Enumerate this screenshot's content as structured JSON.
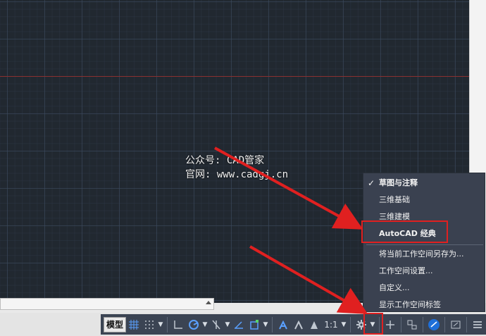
{
  "watermark": {
    "line1": "公众号: CAD管家",
    "line2": "官网: www.cadgj.cn"
  },
  "statusbar": {
    "model_label": "模型",
    "scale_label": "1:1",
    "icons": [
      "grid-icon",
      "snap-icon",
      "ortho-icon",
      "polar-icon",
      "isodraft-icon",
      "osnap-track-icon",
      "osnap-icon",
      "annotation-visibility-icon",
      "auto-scale-icon",
      "annotation-scale-icon",
      "workspace-gear-icon",
      "units-icon",
      "quick-properties-icon",
      "isolate-icon",
      "hardware-accel-icon",
      "clean-screen-icon",
      "customize-menu-icon"
    ]
  },
  "menu": {
    "items": [
      {
        "label": "草图与注释",
        "checked": true,
        "bold": true
      },
      {
        "label": "三维基础",
        "checked": false,
        "bold": false
      },
      {
        "label": "三维建模",
        "checked": false,
        "bold": false
      },
      {
        "label": "AutoCAD 经典",
        "checked": false,
        "bold": true
      },
      {
        "label": "将当前工作空间另存为...",
        "checked": false,
        "bold": false
      },
      {
        "label": "工作空间设置...",
        "checked": false,
        "bold": false
      },
      {
        "label": "自定义...",
        "checked": false,
        "bold": false
      },
      {
        "label": "显示工作空间标签",
        "checked": false,
        "bold": false
      }
    ]
  },
  "colors": {
    "canvas": "#212830",
    "statusbar": "#3b4453",
    "menu": "#3a4150",
    "annotation_red": "#e02020"
  }
}
